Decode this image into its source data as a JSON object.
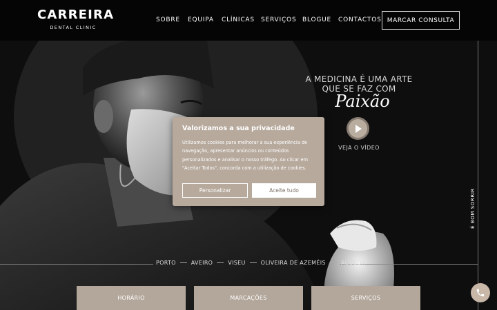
{
  "brand": {
    "name": "CARREIRA",
    "subtitle": "DENTAL CLINIC"
  },
  "nav": {
    "items": [
      "SOBRE",
      "EQUIPA",
      "CLÍNICAS",
      "SERVIÇOS",
      "BLOGUE",
      "CONTACTOS"
    ],
    "cta": "MARCAR CONSULTA"
  },
  "hero": {
    "tagline_line1": "A MEDICINA É UMA ARTE",
    "tagline_line2": "QUE SE FAZ COM",
    "tagline_script": "Paixão",
    "video_label": "VEJA O VÍDEO",
    "side_text": "É BOM SORRIR",
    "cities": [
      "PORTO",
      "AVEIRO",
      "VISEU",
      "OLIVEIRA DE AZEMÉIS",
      "ÁGUEDA"
    ],
    "boxes": [
      "HORÁRIO",
      "MARCAÇÕES",
      "SERVIÇOS"
    ]
  },
  "cookie": {
    "title": "Valorizamos a sua privacidade",
    "text": "Utilizamos cookies para melhorar a sua experiência de navegação, apresentar anúncios ou conteúdos personalizados e analisar o nosso tráfego. Ao clicar em \"Aceitar Todos\", concorda com a utilização de cookies.",
    "customize": "Personalizar",
    "accept": "Aceite tudo"
  },
  "colors": {
    "accent": "#b7aa9d",
    "header_bg": "#050505"
  },
  "icons": {
    "play": "play-icon",
    "phone": "phone-icon"
  }
}
